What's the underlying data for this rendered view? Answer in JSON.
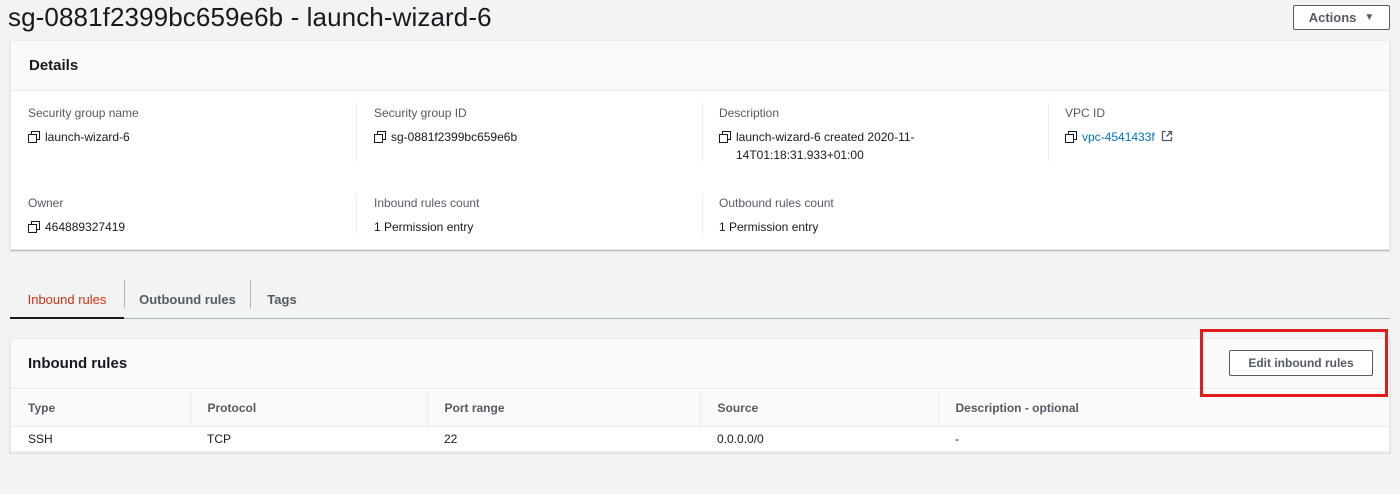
{
  "header": {
    "title": "sg-0881f2399bc659e6b - launch-wizard-6",
    "actions_label": "Actions"
  },
  "details": {
    "title": "Details",
    "fields": {
      "security_group_name": {
        "label": "Security group name",
        "value": "launch-wizard-6"
      },
      "security_group_id": {
        "label": "Security group ID",
        "value": "sg-0881f2399bc659e6b"
      },
      "description": {
        "label": "Description",
        "value_line1": "launch-wizard-6 created 2020-11-",
        "value_line2": "14T01:18:31.933+01:00"
      },
      "vpc_id": {
        "label": "VPC ID",
        "value": "vpc-4541433f"
      },
      "owner": {
        "label": "Owner",
        "value": "464889327419"
      },
      "inbound_rules_count": {
        "label": "Inbound rules count",
        "value": "1 Permission entry"
      },
      "outbound_rules_count": {
        "label": "Outbound rules count",
        "value": "1 Permission entry"
      }
    }
  },
  "tabs": [
    {
      "label": "Inbound rules",
      "active": true
    },
    {
      "label": "Outbound rules",
      "active": false
    },
    {
      "label": "Tags",
      "active": false
    }
  ],
  "inbound": {
    "title": "Inbound rules",
    "edit_label": "Edit inbound rules",
    "columns": [
      "Type",
      "Protocol",
      "Port range",
      "Source",
      "Description - optional"
    ],
    "rows": [
      [
        "SSH",
        "TCP",
        "22",
        "0.0.0.0/0",
        "-"
      ]
    ]
  },
  "colors": {
    "active_tab": "#d13212",
    "link": "#0073bb",
    "highlight": "#e01c1c"
  }
}
